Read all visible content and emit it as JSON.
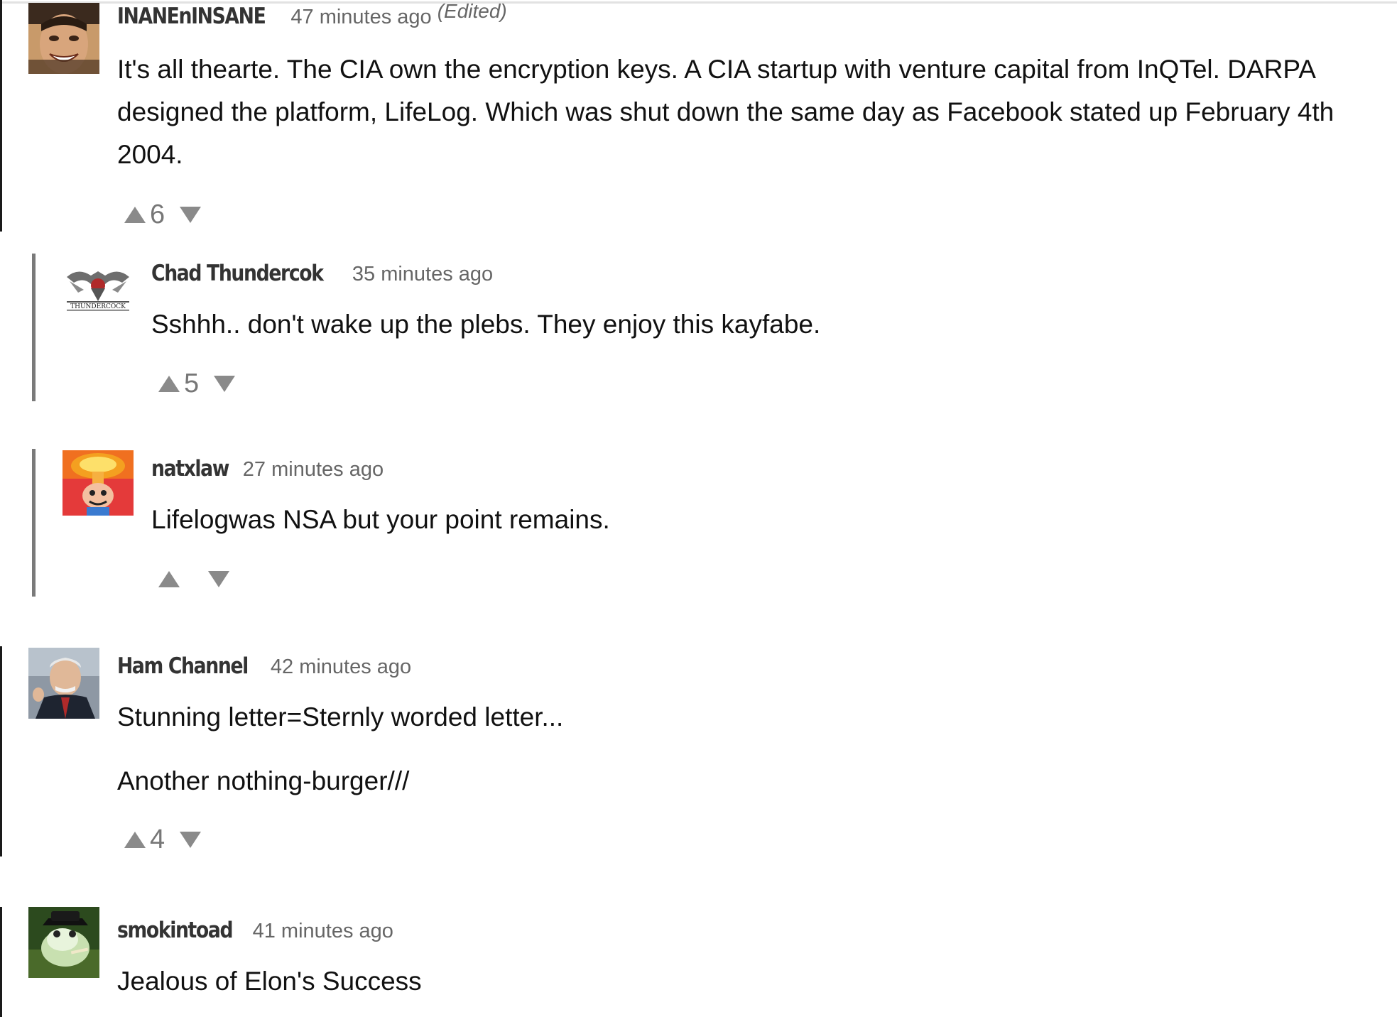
{
  "comments": [
    {
      "username": "INANEnINSANE",
      "timestamp": "47 minutes ago",
      "edited_label": "(Edited)",
      "avatar_icon": "avatar-man-grinning-icon",
      "paragraphs": [
        "It's all thearte. The CIA own the encryption keys. A CIA startup with venture capital from InQTel. DARPA designed the platform, LifeLog. Which was shut down the same day as Facebook stated up February 4th 2004."
      ],
      "votes": "6"
    },
    {
      "username": "Chad Thundercok",
      "timestamp": "35 minutes ago",
      "avatar_icon": "avatar-thundercock-emblem-icon",
      "avatar_text": "THUNDERCOCK",
      "paragraphs": [
        "Sshhh.. don't wake up the plebs. They enjoy this kayfabe."
      ],
      "votes": "5"
    },
    {
      "username": "natxlaw",
      "timestamp": "27 minutes ago",
      "avatar_icon": "avatar-mushroom-cloud-icon",
      "paragraphs": [
        "Lifelogwas NSA but your point remains."
      ],
      "votes": ""
    },
    {
      "username": "Ham Channel",
      "timestamp": "42 minutes ago",
      "avatar_icon": "avatar-man-mustache-icon",
      "paragraphs": [
        "Stunning letter=Sternly worded letter...",
        "Another nothing-burger///"
      ],
      "votes": "4"
    },
    {
      "username": "smokintoad",
      "timestamp": "41 minutes ago",
      "avatar_icon": "avatar-toad-hat-icon",
      "paragraphs": [
        "Jealous of Elon's Success"
      ]
    }
  ],
  "colors": {
    "thread_bar": "#1a1a1a",
    "reply_bar": "#7a7a7a",
    "vote_arrow": "#8a8a8a",
    "username": "#333333",
    "timestamp": "#666666"
  }
}
